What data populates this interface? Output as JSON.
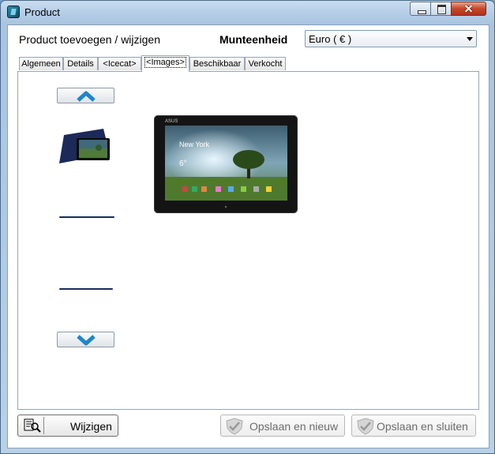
{
  "window": {
    "title": "Product",
    "icon": "product-app-icon",
    "controls": {
      "minimize": "minimize-icon",
      "maximize": "maximize-icon",
      "close": "✕"
    }
  },
  "header": {
    "title": "Product toevoegen / wijzigen",
    "currency_label": "Munteenheid",
    "currency_value": "Euro ( € )"
  },
  "tabs": [
    {
      "label": "Algemeen",
      "active": false
    },
    {
      "label": "Details",
      "active": false
    },
    {
      "label": "<Icecat>",
      "active": false
    },
    {
      "label": "<Images>",
      "active": true
    },
    {
      "label": "Beschikbaar",
      "active": false
    },
    {
      "label": "Verkocht",
      "active": false
    }
  ],
  "images_panel": {
    "scroll_up_icon": "chevron-up-icon",
    "scroll_down_icon": "chevron-down-icon",
    "thumbnails": [
      "tablet-front-thumbnail",
      "tablet-edge-thumbnail",
      "tablet-edge-thumbnail"
    ],
    "main_image": {
      "brand": "ASUS",
      "city": "New York",
      "temperature": "6°"
    }
  },
  "footer": {
    "edit_label": "Wijzigen",
    "edit_icon": "document-search-icon",
    "save_new_label": "Opslaan en nieuw",
    "save_close_label": "Opslaan en sluiten",
    "save_icon": "shield-check-icon",
    "save_enabled": false
  },
  "colors": {
    "frame": "#b7cfe8",
    "accent_chevron": "#1f86c8",
    "tablet_body": "#1c2a5a"
  }
}
